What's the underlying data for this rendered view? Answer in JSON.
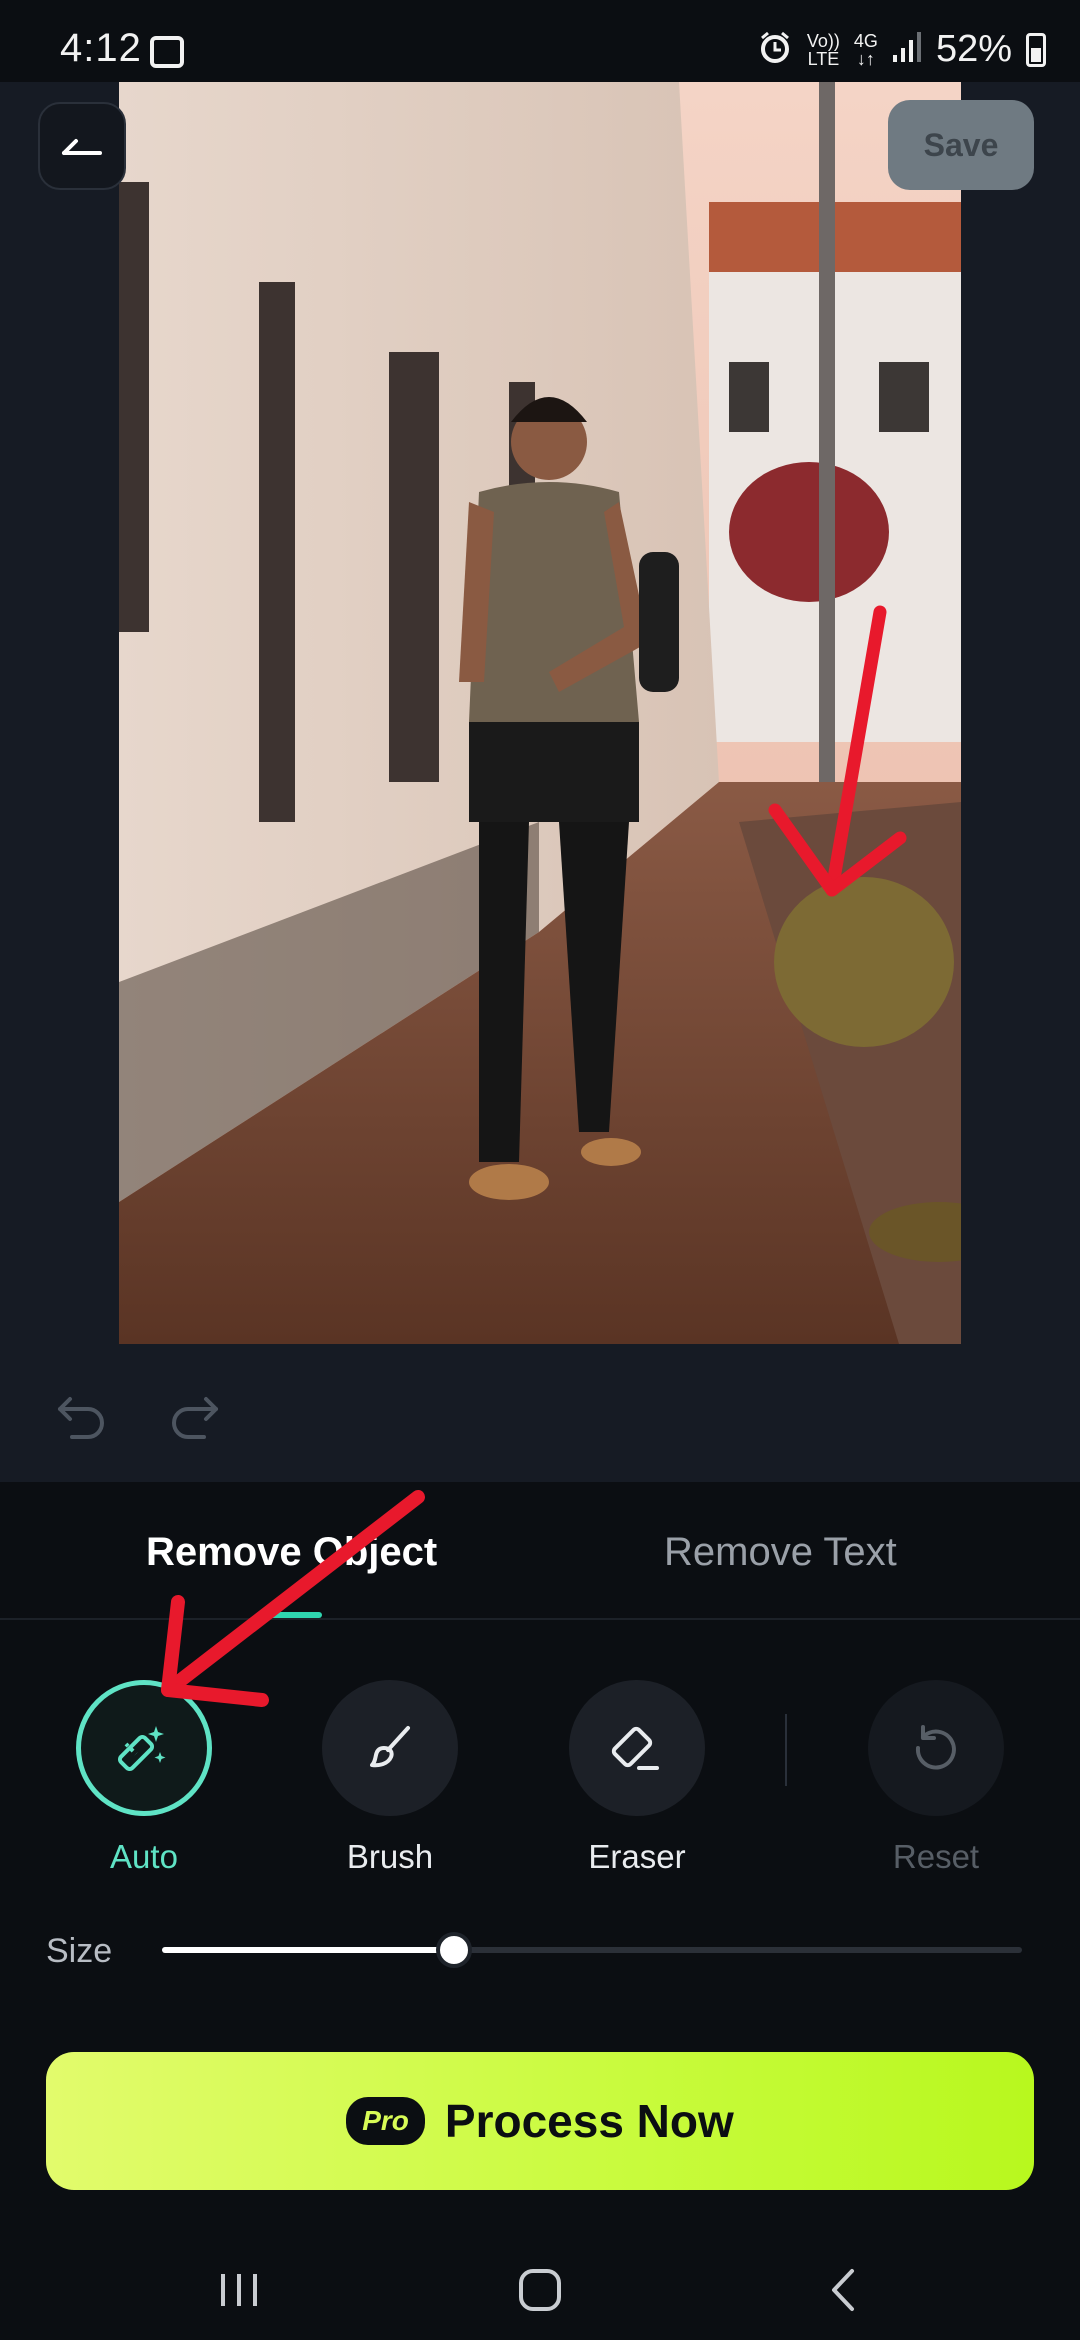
{
  "status_bar": {
    "time": "4:12",
    "network_top": "Vo))",
    "network_bottom": "LTE",
    "data_top": "4G",
    "data_bottom": "↓↑",
    "battery": "52%",
    "icons": [
      "gallery-icon",
      "alarm-icon",
      "signal-icon",
      "battery-icon"
    ]
  },
  "header": {
    "back_icon": "back-arrow-icon",
    "save_label": "Save"
  },
  "history": {
    "undo_icon": "undo-icon",
    "redo_icon": "redo-icon"
  },
  "tabs": [
    {
      "label": "Remove Object",
      "active": true
    },
    {
      "label": "Remove Text",
      "active": false
    }
  ],
  "tools": [
    {
      "label": "Auto",
      "icon": "magic-wand-icon",
      "selected": true
    },
    {
      "label": "Brush",
      "icon": "brush-icon",
      "selected": false
    },
    {
      "label": "Eraser",
      "icon": "eraser-icon",
      "selected": false
    },
    {
      "label": "Reset",
      "icon": "reset-icon",
      "enabled": false
    }
  ],
  "size": {
    "label": "Size",
    "value": 0.34
  },
  "process": {
    "badge": "Pro",
    "label": "Process Now"
  },
  "colors": {
    "accent": "#5fe3c5",
    "process_button": "#c8fb3c",
    "annotation": "#e8192c"
  }
}
